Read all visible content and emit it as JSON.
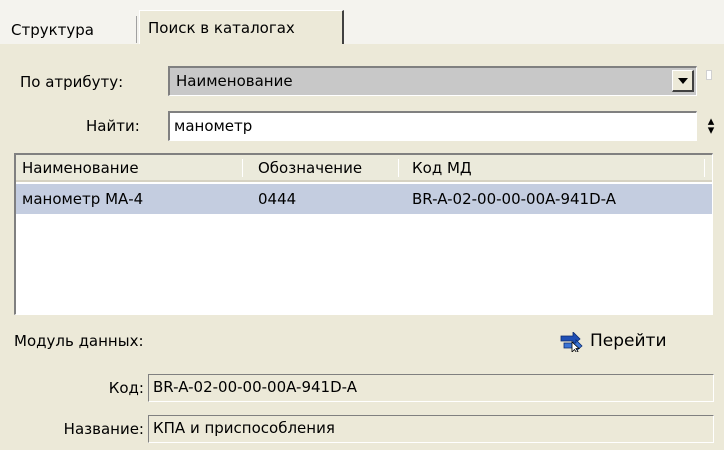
{
  "tabs": [
    {
      "label": "Структура"
    },
    {
      "label": "Поиск в каталогах"
    }
  ],
  "search": {
    "attribute_label": "По атрибуту:",
    "attribute_value": "Наименование",
    "find_label": "Найти:",
    "find_value": "манометр"
  },
  "results": {
    "columns": [
      "Наименование",
      "Обозначение",
      "Код МД"
    ],
    "rows": [
      [
        "манометр МА-4",
        "0444",
        "BR-A-02-00-00-00A-941D-A"
      ]
    ]
  },
  "module": {
    "section_label": "Модуль данных:",
    "goto_label": "Перейти",
    "goto_icon": "goto-arrow-icon",
    "code_label": "Код:",
    "code_value": "BR-A-02-00-00-00A-941D-A",
    "name_label": "Название:",
    "name_value": "КПА и приспособления"
  },
  "colors": {
    "background": "#ece9d8",
    "selected_row": "#c4cde0",
    "goto_icon_blue": "#1f4fb5"
  }
}
